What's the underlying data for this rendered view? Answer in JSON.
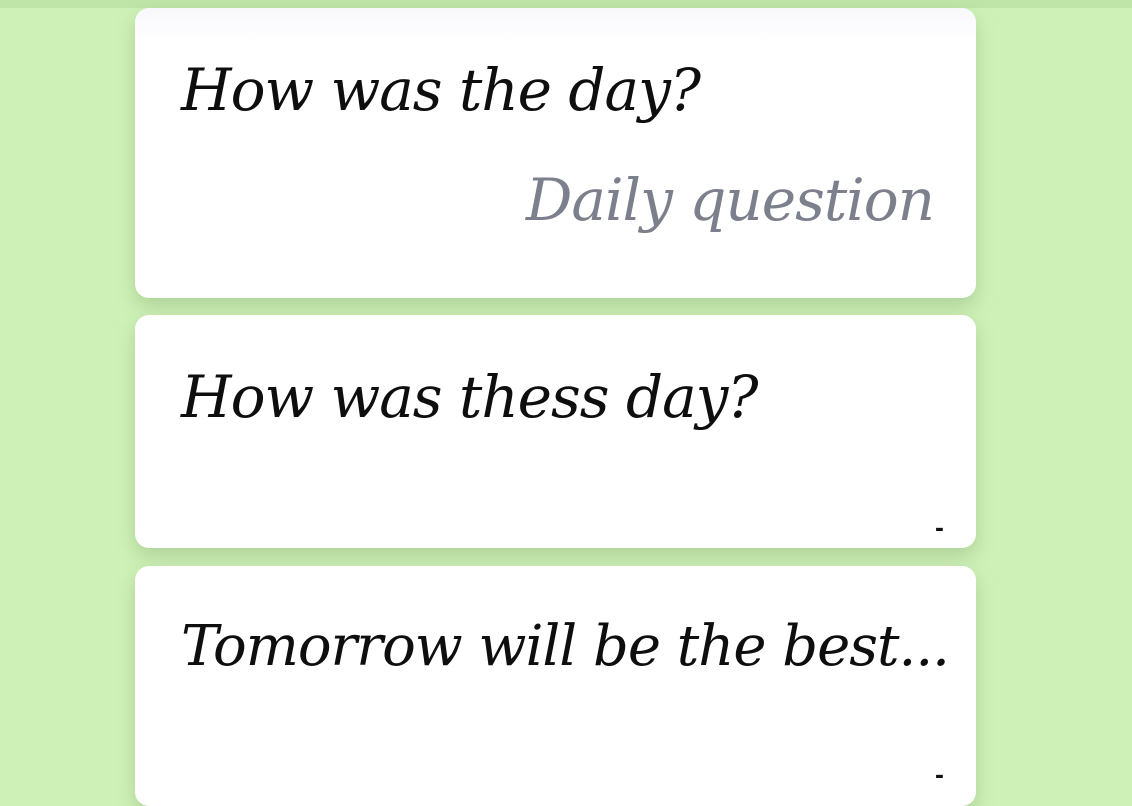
{
  "entries": [
    {
      "text": "How was the day?",
      "label": "Daily question"
    },
    {
      "text": "How was thess day?",
      "meta": "-"
    },
    {
      "text": "Tomorrow will be the best...",
      "meta": "-"
    }
  ],
  "colors": {
    "background": "#cef1b7",
    "card": "#ffffff",
    "text": "#0e0e0e",
    "label": "#7c7f8c"
  }
}
